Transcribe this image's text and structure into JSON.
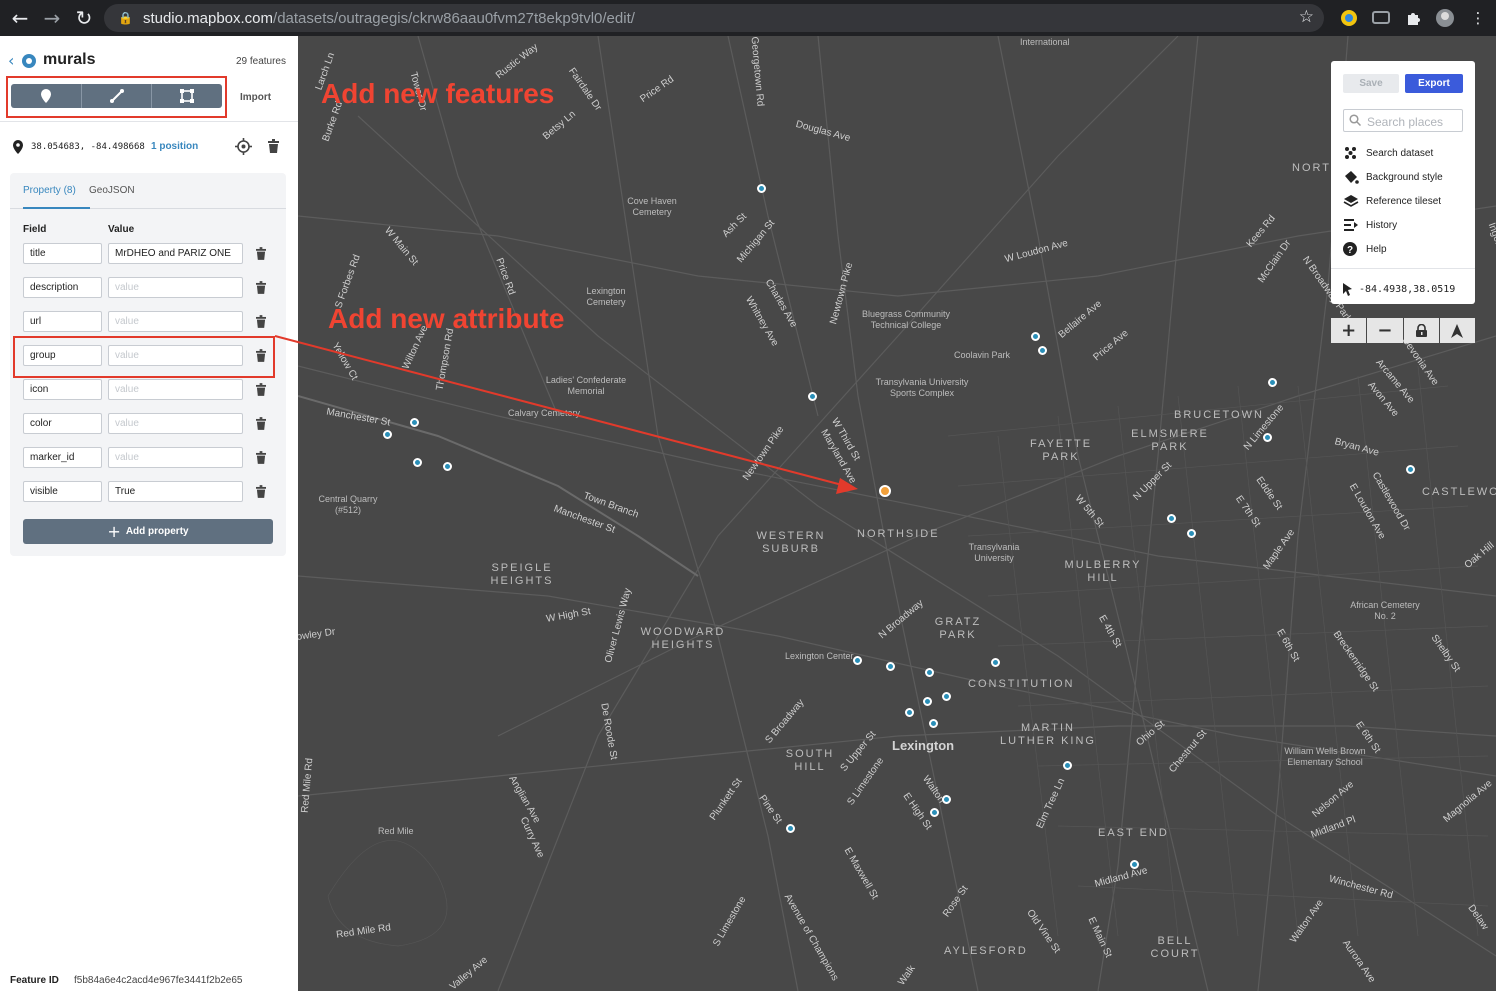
{
  "browser": {
    "url_host": "studio.mapbox.com",
    "url_path": "/datasets/outragegis/ckrw86aau0fvm27t8ekp9tvl0/edit/"
  },
  "sidebar": {
    "dataset_name": "murals",
    "feature_count": "29 features",
    "draw_tools": [
      "marker-icon",
      "line-icon",
      "polygon-icon"
    ],
    "import_label": "Import",
    "coordinates": "38.054683, -84.498668",
    "position_link": "1 position",
    "tabs": {
      "property": "Property (8)",
      "geojson": "GeoJSON"
    },
    "columns": {
      "field": "Field",
      "value": "Value"
    },
    "properties": [
      {
        "field": "title",
        "value": "MrDHEO and PARIZ ONE",
        "placeholder": ""
      },
      {
        "field": "description",
        "value": "",
        "placeholder": "value"
      },
      {
        "field": "url",
        "value": "",
        "placeholder": "value"
      },
      {
        "field": "group",
        "value": "",
        "placeholder": "value"
      },
      {
        "field": "icon",
        "value": "",
        "placeholder": "value"
      },
      {
        "field": "color",
        "value": "",
        "placeholder": "value"
      },
      {
        "field": "marker_id",
        "value": "",
        "placeholder": "value"
      },
      {
        "field": "visible",
        "value": "True",
        "placeholder": ""
      }
    ],
    "add_property_label": "Add property",
    "feature_id_label": "Feature ID",
    "feature_id": "f5b84a6e4c2acd4e967fe3441f2b2e65"
  },
  "annotations": {
    "add_features": "Add new features",
    "add_attribute": "Add new attribute"
  },
  "right_panel": {
    "save_label": "Save",
    "export_label": "Export",
    "search_placeholder": "Search places",
    "menu": [
      {
        "icon": "search-dataset-icon",
        "label": "Search dataset"
      },
      {
        "icon": "paint-bucket-icon",
        "label": "Background style"
      },
      {
        "icon": "layers-icon",
        "label": "Reference tileset"
      },
      {
        "icon": "history-icon",
        "label": "History"
      },
      {
        "icon": "help-icon",
        "label": "Help"
      }
    ],
    "cursor_coords": "-84.4938,38.0519",
    "zoom_controls": [
      "+",
      "−",
      "lock-icon",
      "compass-icon"
    ]
  },
  "colors": {
    "accent": "#3887be",
    "annotation": "#e23a2b",
    "marker": "#2a8fb8",
    "selected_marker": "#f3a13b",
    "export": "#3b5bdb"
  },
  "map": {
    "neighborhoods": [
      "BRUCETOWN",
      "FAYETTE PARK",
      "ELMSMERE PARK",
      "NORTHSIDE",
      "WESTERN SUBURB",
      "SPEIGLE HEIGHTS",
      "WOODWARD HEIGHTS",
      "GRATZ PARK",
      "CONSTITUTION",
      "MULBERRY HILL",
      "MARTIN LUTHER KING",
      "SOUTH HILL",
      "EAST END",
      "BELL COURT",
      "AYLESFORD",
      "CASTLEWO",
      "NORT"
    ],
    "city": "Lexington",
    "pois": [
      "Cove Haven Cemetery",
      "Lexington Cemetery",
      "Bluegrass Community Technical College",
      "Coolavin Park",
      "Transylvania University Sports Complex",
      "Ladies' Confederate Memorial",
      "Calvary Cemetery",
      "Central Quarry (#512)",
      "Transylvania University",
      "Lexington Center",
      "African Cemetery No. 2",
      "William Wells Brown Elementary School",
      "Red Mile",
      "International"
    ],
    "streets": [
      "Rustic Way",
      "Fairdale Dr",
      "Price Rd",
      "Georgetown Rd",
      "Douglas Ave",
      "Ash St",
      "Michigan St",
      "Charles Ave",
      "Whitney Ave",
      "Newtown Pike",
      "W Main St",
      "S Forbes Rd",
      "Price Rd",
      "W Loudon Ave",
      "Kees Rd",
      "McClain Dr",
      "N Broadway Park",
      "Bellaire Ave",
      "Price Ave",
      "Devonia Ave",
      "Arcame Ave",
      "Avon Ave",
      "Manchester St",
      "W Third St",
      "Maryland Ave",
      "Newtown Pike",
      "N Limestone",
      "Bryan Ave",
      "Castlewood Dr",
      "E Loudon Ave",
      "N Upper St",
      "W 5th St",
      "Eddie St",
      "E 7th St",
      "Maple Ave",
      "W High St",
      "Oliver Lewis Way",
      "N Broadway",
      "E 4th St",
      "E 6th St",
      "Breckenridge St",
      "Shelby St",
      "De Roode St",
      "S Broadway",
      "S Upper St",
      "S Limestone",
      "Walton",
      "E High St",
      "Ohio St",
      "Chestnut St",
      "E 6th St",
      "Elm Tree Ln",
      "Nelson Ave",
      "Midland Pl",
      "Magnolia Ave",
      "Anglian Ave",
      "Curry Ave",
      "Plunkett St",
      "Pine St",
      "E Maxwell St",
      "Rose St",
      "Old Vine St",
      "E Main St",
      "Midland Ave",
      "Winchester Rd",
      "Walton Ave",
      "Aurora Ave",
      "Red Mile Rd",
      "Red Mile Rd",
      "S Limestone",
      "Avenue of Champions",
      "Manchester St",
      "Town Branch",
      "Burke Rd",
      "Larch Ln",
      "Tower Dr",
      "Betsy Ln",
      "Oak Hill",
      "Delaw",
      "Yellow Ct",
      "Thompson Rd",
      "Wilton Ave",
      "Walk",
      "Crowley Dr",
      "Valley Ave",
      "Ingels St"
    ]
  }
}
